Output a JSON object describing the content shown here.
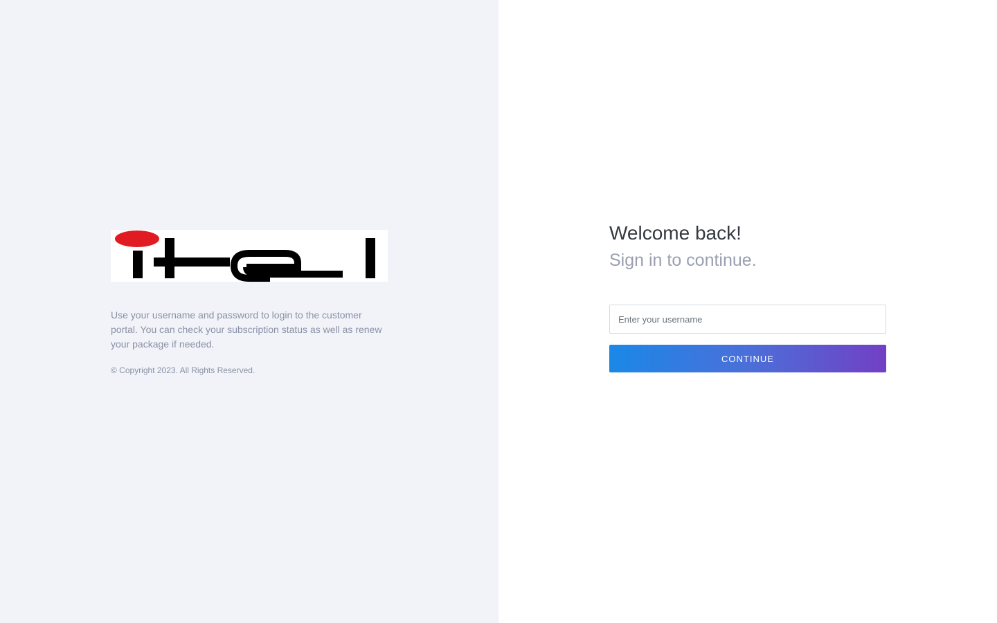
{
  "brand": {
    "logo_text": "itel",
    "logo_colors": {
      "dot": "#e11b22",
      "letters": "#000000"
    },
    "description": "Use your username and password to login to the customer portal. You can check your subscription status as well as renew your package if needed.",
    "copyright": "© Copyright 2023. All Rights Reserved."
  },
  "auth": {
    "title": "Welcome back!",
    "subtitle": "Sign in to continue.",
    "username_placeholder": "Enter your username",
    "username_value": "",
    "continue_label": "CONTINUE"
  },
  "colors": {
    "left_background": "#f1f3f8",
    "right_background": "#ffffff",
    "button_gradient_start": "#1a88e7",
    "button_gradient_end": "#7240c4"
  }
}
